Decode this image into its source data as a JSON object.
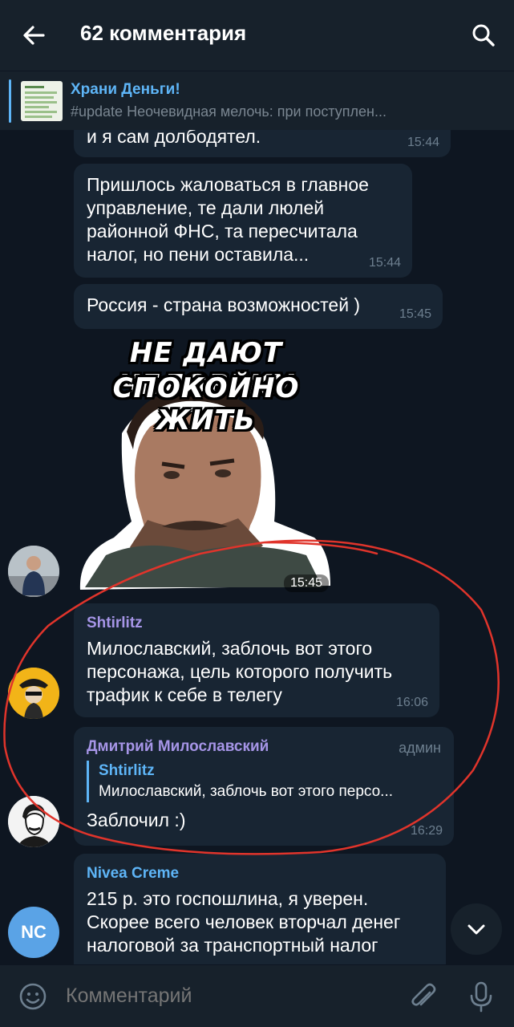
{
  "header": {
    "title": "62 комментария"
  },
  "pinned": {
    "title": "Храни Деньги!",
    "text": "#update  Неочевидная мелочь: при поступлен..."
  },
  "messages": [
    {
      "text": "и я сам долбодятел.",
      "time": "15:44"
    },
    {
      "text": "Пришлось жаловаться в главное управление, те дали люлей районной ФНС, та пересчитала налог, но пени оставила...",
      "time": "15:44"
    },
    {
      "text": "Россия - страна возможностей )",
      "time": "15:45"
    }
  ],
  "sticker": {
    "line1": "НЕ ДАЮТ ЧЕЛОВЕКУ",
    "line2": "СПОКОЙНО ЖИТЬ",
    "time": "15:45"
  },
  "msg_shtirlitz": {
    "sender": "Shtirlitz",
    "sender_color": "#a695e7",
    "text": "Милославский, заблочь вот этого персонажа, цель которого получить трафик к себе в телегу",
    "time": "16:06"
  },
  "msg_admin": {
    "sender": "Дмитрий Милославский",
    "sender_color": "#a695e7",
    "badge": "админ",
    "reply_name": "Shtirlitz",
    "reply_text": "Милославский, заблочь вот этого персо...",
    "text": "Заблочил :)",
    "time": "16:29"
  },
  "msg_nivea": {
    "sender": "Nivea Creme",
    "sender_color": "#5eb5f7",
    "avatar_initials": "NC",
    "avatar_color": "#5aa3e6",
    "text": "215 р. это госпошлина, я уверен. Скорее всего человек вторчал денег налоговой за транспортный налог"
  },
  "input": {
    "placeholder": "Комментарий"
  },
  "colors": {
    "background": "#0e1621",
    "bar": "#17212b",
    "bubble": "#182533",
    "accent": "#5eb5f7",
    "annotation": "#e0342b"
  },
  "icons": [
    "back-arrow-icon",
    "search-icon",
    "chevron-down-icon",
    "emoji-icon",
    "paperclip-icon",
    "microphone-icon"
  ]
}
